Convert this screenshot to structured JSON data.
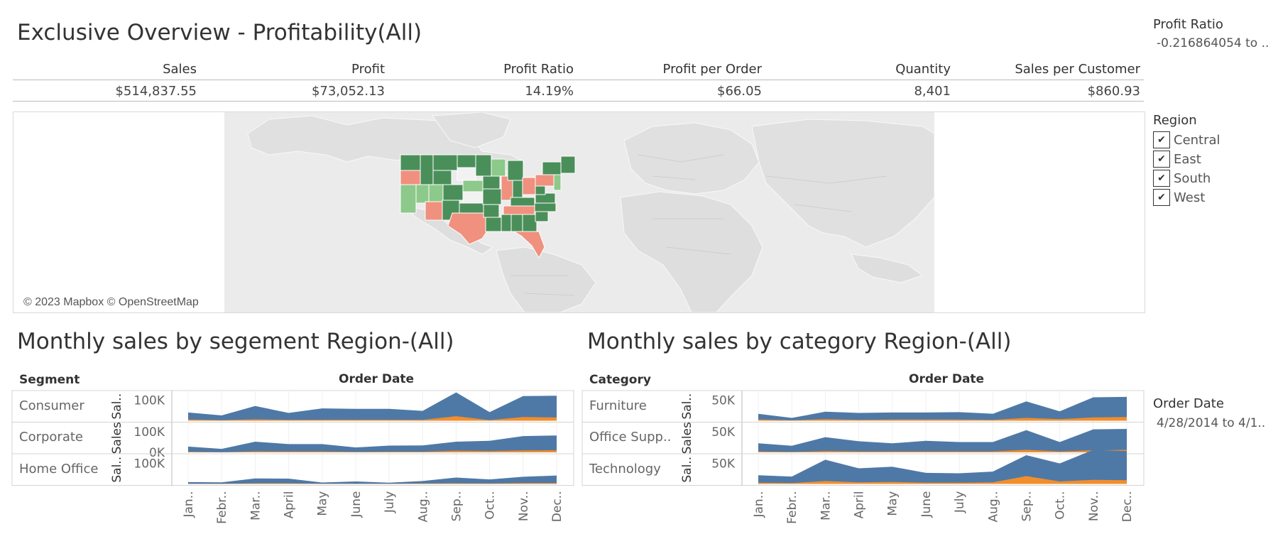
{
  "dashboard": {
    "title": "Exclusive Overview - Profitability(All)",
    "kpis": [
      {
        "label": "Sales",
        "value": "$514,837.55"
      },
      {
        "label": "Profit",
        "value": "$73,052.13"
      },
      {
        "label": "Profit Ratio",
        "value": "14.19%"
      },
      {
        "label": "Profit per Order",
        "value": "$66.05"
      },
      {
        "label": "Quantity",
        "value": "8,401"
      },
      {
        "label": "Sales per Customer",
        "value": "$860.93"
      }
    ]
  },
  "map": {
    "attribution": "© 2023 Mapbox © OpenStreetMap",
    "colors": {
      "land": "#e3e3e3",
      "profit_high": "#4a8f5a",
      "profit_mid": "#8cc98a",
      "loss": "#f0907e",
      "neutral": "#f2f2f2"
    }
  },
  "filters": {
    "profit_ratio": {
      "title": "Profit Ratio",
      "value": "-0.216864054 to .."
    },
    "region": {
      "title": "Region",
      "options": [
        "Central",
        "East",
        "South",
        "West"
      ]
    },
    "order_date": {
      "title": "Order Date",
      "value": "4/28/2014 to 4/1.."
    }
  },
  "chart_data": [
    {
      "type": "area",
      "title": "Monthly sales by segement Region-(All)",
      "row_header": "Segment",
      "xlabel": "Order Date",
      "months": [
        "Jan..",
        "Febr..",
        "Mar..",
        "April",
        "May",
        "June",
        "July",
        "Aug..",
        "Sep..",
        "Oct..",
        "Nov..",
        "Dec.."
      ],
      "colors": {
        "sales": "#4e79a7",
        "profit": "#f28e2b"
      },
      "panels": [
        {
          "name": "Consumer",
          "axis_title": "Sal..",
          "ticks": [
            "100K"
          ],
          "ylim": [
            0,
            140000
          ],
          "sales": [
            40000,
            26000,
            72000,
            38000,
            60000,
            58000,
            58000,
            48000,
            138000,
            42000,
            120000,
            122000
          ],
          "profit": [
            6000,
            3000,
            7000,
            4000,
            5000,
            5000,
            5000,
            4000,
            22000,
            3000,
            18000,
            16000
          ]
        },
        {
          "name": "Corporate",
          "axis_title": "Sales",
          "ticks": [
            "100K",
            "0K"
          ],
          "ylim": [
            0,
            140000
          ],
          "sales": [
            28000,
            17000,
            52000,
            40000,
            40000,
            24000,
            33000,
            34000,
            52000,
            56000,
            79000,
            82000
          ],
          "profit": [
            3000,
            1000,
            5000,
            4000,
            4000,
            2000,
            3000,
            3000,
            8000,
            6000,
            9000,
            10000
          ]
        },
        {
          "name": "Home Office",
          "axis_title": "Sal..",
          "ticks": [
            "100K"
          ],
          "ylim": [
            0,
            140000
          ],
          "sales": [
            9000,
            8000,
            27000,
            26000,
            7000,
            12000,
            6000,
            14000,
            31000,
            22000,
            35000,
            41000
          ],
          "profit": [
            1000,
            1000,
            3000,
            3000,
            1000,
            1000,
            1000,
            2000,
            3000,
            2000,
            4000,
            4000
          ]
        }
      ]
    },
    {
      "type": "area",
      "title": "Monthly sales by category Region-(All)",
      "row_header": "Category",
      "xlabel": "Order Date",
      "months": [
        "Jan..",
        "Febr..",
        "Mar..",
        "April",
        "May",
        "June",
        "July",
        "Aug..",
        "Sep..",
        "Oct..",
        "Nov..",
        "Dec.."
      ],
      "colors": {
        "sales": "#4e79a7",
        "profit": "#f28e2b"
      },
      "panels": [
        {
          "name": "Furniture",
          "axis_title": "Sal..",
          "ticks": [
            "50K"
          ],
          "ylim": [
            0,
            70000
          ],
          "sales": [
            17000,
            7000,
            22000,
            19000,
            20000,
            20000,
            21000,
            17000,
            47000,
            23000,
            57000,
            58000
          ],
          "profit": [
            3000,
            1000,
            4000,
            2000,
            3000,
            3000,
            3000,
            2000,
            7000,
            4000,
            8000,
            9000
          ]
        },
        {
          "name": "Office Supp..",
          "axis_title": "Sales",
          "ticks": [
            "50K"
          ],
          "ylim": [
            0,
            70000
          ],
          "sales": [
            22000,
            16000,
            37000,
            27000,
            22000,
            28000,
            25000,
            25000,
            54000,
            25000,
            56000,
            57000
          ],
          "profit": [
            2000,
            1000,
            3000,
            2000,
            2000,
            2000,
            2000,
            2000,
            6000,
            2000,
            5000,
            6000
          ]
        },
        {
          "name": "Technology",
          "axis_title": "Sal..",
          "ticks": [
            "50K"
          ],
          "ylim": [
            0,
            70000
          ],
          "sales": [
            21000,
            18000,
            59000,
            38000,
            42000,
            27000,
            26000,
            30000,
            70000,
            50000,
            83000,
            80000
          ],
          "profit": [
            3000,
            2000,
            7000,
            4000,
            5000,
            3000,
            3000,
            4000,
            19000,
            6000,
            10000,
            9000
          ]
        }
      ]
    }
  ]
}
